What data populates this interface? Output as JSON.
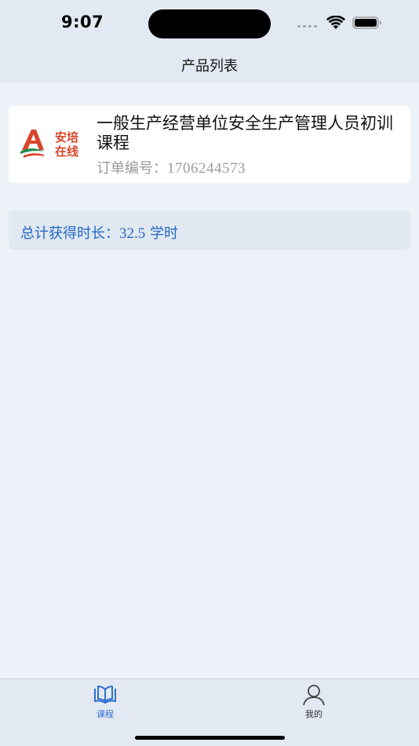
{
  "status_bar": {
    "time": "9:07"
  },
  "nav": {
    "title": "产品列表"
  },
  "product": {
    "logo_text_top": "安培",
    "logo_text_bottom": "在线",
    "title": "一般生产经营单位安全生产管理人员初训课程",
    "order_label": "订单编号：",
    "order_number": "1706244573"
  },
  "summary": {
    "label": "总计获得时长：",
    "value": "32.5",
    "unit": "学时"
  },
  "tabbar": {
    "items": [
      {
        "label": "课程",
        "icon": "book-open-icon",
        "active": true
      },
      {
        "label": "我的",
        "icon": "person-icon",
        "active": false
      }
    ]
  },
  "colors": {
    "accent": "#2f6fd1",
    "summary_text": "#2468c6",
    "background": "#edf2f8",
    "header": "#e2e9f2",
    "logo_red": "#d9452b",
    "logo_green": "#1f8a4c"
  }
}
